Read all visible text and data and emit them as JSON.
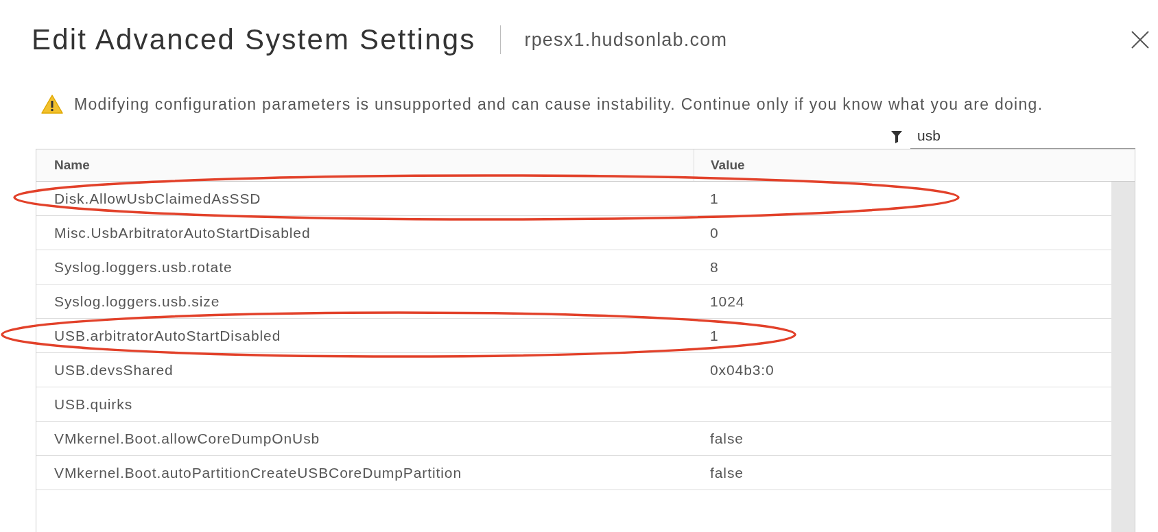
{
  "dialog": {
    "title": "Edit Advanced System Settings",
    "host": "rpesx1.hudsonlab.com"
  },
  "warning": "Modifying configuration parameters is unsupported and can cause instability. Continue only if you know what you are doing.",
  "filter": {
    "value": "usb"
  },
  "table": {
    "columns": [
      "Name",
      "Value"
    ],
    "rows": [
      {
        "name": "Disk.AllowUsbClaimedAsSSD",
        "value": "1",
        "circled": true
      },
      {
        "name": "Misc.UsbArbitratorAutoStartDisabled",
        "value": "0",
        "circled": false
      },
      {
        "name": "Syslog.loggers.usb.rotate",
        "value": "8",
        "circled": false
      },
      {
        "name": "Syslog.loggers.usb.size",
        "value": "1024",
        "circled": false
      },
      {
        "name": "USB.arbitratorAutoStartDisabled",
        "value": "1",
        "circled": true
      },
      {
        "name": "USB.devsShared",
        "value": "0x04b3:0",
        "circled": false
      },
      {
        "name": "USB.quirks",
        "circled": false
      },
      {
        "name": "VMkernel.Boot.allowCoreDumpOnUsb",
        "value": "false",
        "circled": false
      },
      {
        "name": "VMkernel.Boot.autoPartitionCreateUSBCoreDumpPartition",
        "value": "false",
        "circled": false
      }
    ]
  }
}
